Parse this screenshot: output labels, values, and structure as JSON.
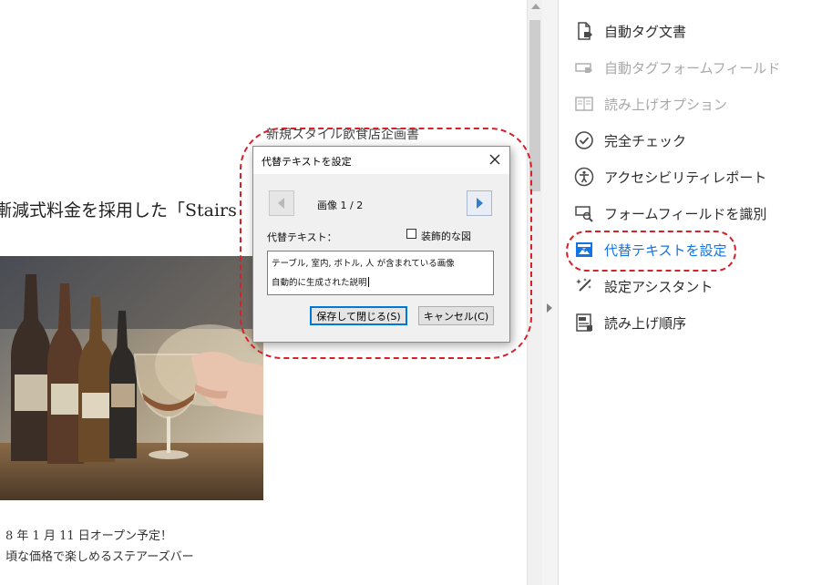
{
  "document": {
    "heading_top": "新規スタイル飲食店企画書",
    "heading_main": "漸減式料金を採用した「Stairs",
    "line1": "8 年 1 月 11 日オープン予定！",
    "line2": "頃な価格で楽しめるステアーズバー"
  },
  "dialog": {
    "title": "代替テキストを設定",
    "image_counter": "画像 1 / 2",
    "alt_label": "代替テキスト：",
    "decorative_label": "装飾的な図",
    "decorative_checked": false,
    "alt_text_line1": "テーブル, 室内, ボトル, 人 が含まれている画像",
    "alt_text_line2": "自動的に生成された説明",
    "save_button": "保存して閉じる(S)",
    "cancel_button": "キャンセル(C)"
  },
  "tools_panel": {
    "items": [
      {
        "label": "自動タグ文書",
        "icon": "document-tag-icon",
        "state": "normal"
      },
      {
        "label": "自動タグフォームフィールド",
        "icon": "form-field-tag-icon",
        "state": "disabled"
      },
      {
        "label": "読み上げオプション",
        "icon": "reading-options-icon",
        "state": "disabled"
      },
      {
        "label": "完全チェック",
        "icon": "check-circle-icon",
        "state": "normal"
      },
      {
        "label": "アクセシビリティレポート",
        "icon": "accessibility-icon",
        "state": "normal"
      },
      {
        "label": "フォームフィールドを識別",
        "icon": "identify-form-fields-icon",
        "state": "normal"
      },
      {
        "label": "代替テキストを設定",
        "icon": "alt-text-icon",
        "state": "selected"
      },
      {
        "label": "設定アシスタント",
        "icon": "magic-wand-icon",
        "state": "normal"
      },
      {
        "label": "読み上げ順序",
        "icon": "reading-order-icon",
        "state": "normal"
      }
    ]
  },
  "colors": {
    "highlight": "#d6202a",
    "selected_text": "#1473e6",
    "disabled_text": "#a8a8a8"
  }
}
